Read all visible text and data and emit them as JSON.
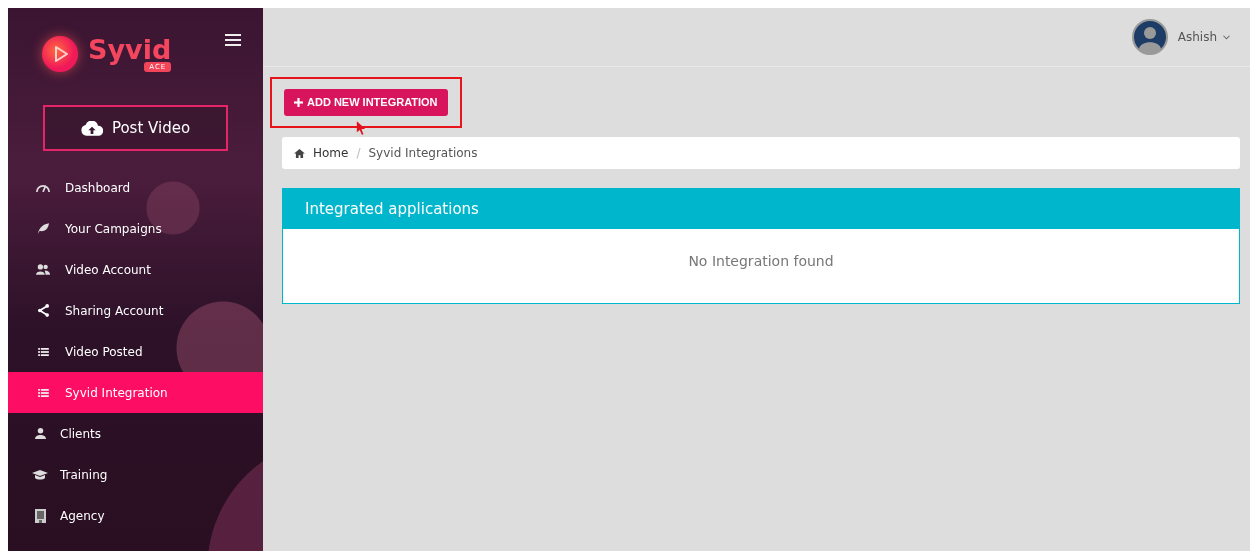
{
  "brand": {
    "name": "Syvid",
    "badge": "ACE"
  },
  "post_button": {
    "label": "Post Video"
  },
  "sidebar": {
    "items": [
      {
        "label": "Dashboard",
        "selected": false,
        "kind": "sub"
      },
      {
        "label": "Your Campaigns",
        "selected": false,
        "kind": "sub"
      },
      {
        "label": "Video Account",
        "selected": false,
        "kind": "sub"
      },
      {
        "label": "Sharing Account",
        "selected": false,
        "kind": "sub"
      },
      {
        "label": "Video Posted",
        "selected": false,
        "kind": "sub"
      },
      {
        "label": "Syvid Integration",
        "selected": true,
        "kind": "sub"
      },
      {
        "label": "Clients",
        "selected": false,
        "kind": "top"
      },
      {
        "label": "Training",
        "selected": false,
        "kind": "top"
      },
      {
        "label": "Agency",
        "selected": false,
        "kind": "top"
      }
    ]
  },
  "user": {
    "name": "Ashish"
  },
  "add_button": {
    "label": "ADD NEW INTEGRATION",
    "highlighted": true
  },
  "breadcrumb": {
    "separator": "/",
    "items": [
      "Home",
      "Syvid Integrations"
    ]
  },
  "panel": {
    "title": "Integrated applications",
    "empty_text": "No Integration found"
  }
}
